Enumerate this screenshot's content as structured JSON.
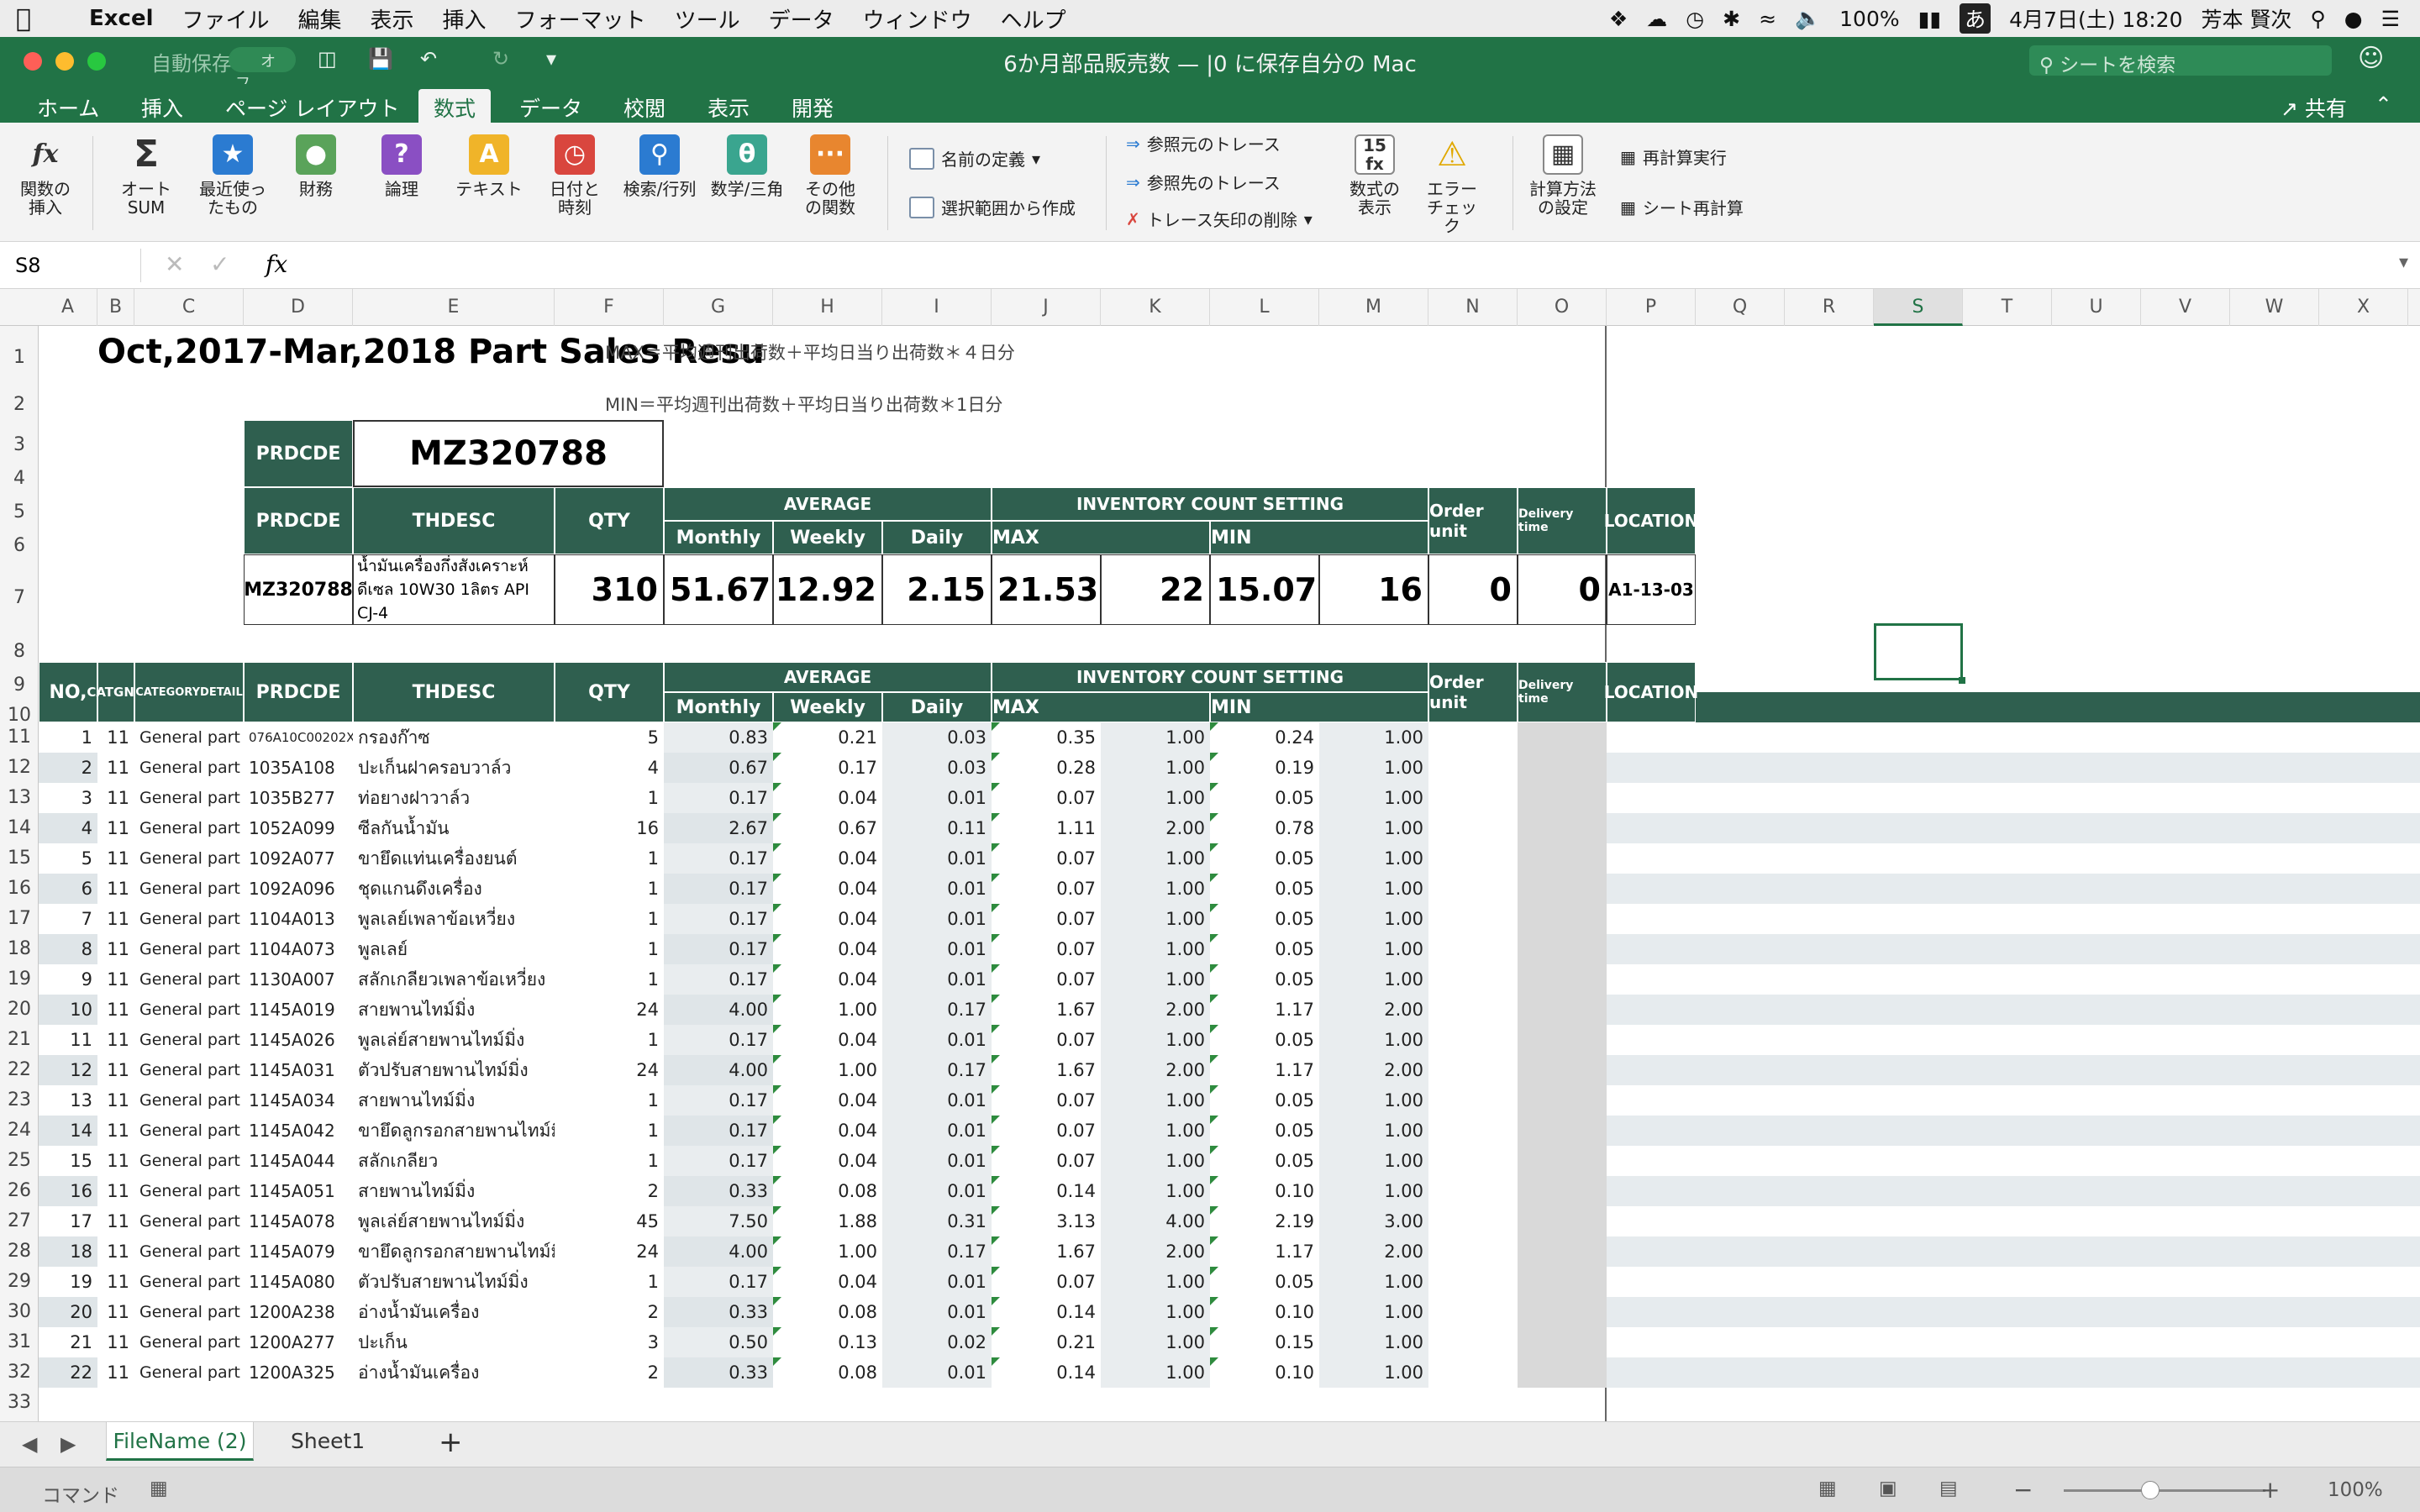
{
  "menubar": {
    "app": "Excel",
    "items": [
      "ファイル",
      "編集",
      "表示",
      "挿入",
      "フォーマット",
      "ツール",
      "データ",
      "ウィンドウ",
      "ヘルプ"
    ],
    "battery": "100%",
    "input": "あ",
    "datetime": "4月7日(土)  18:20",
    "user": "芳本 賢次"
  },
  "titlebar": {
    "autosave": "自動保存",
    "autosave_state": "オフ",
    "title": "6か月部品販売数 — |0 に保存自分の Mac",
    "search_placeholder": "シートを検索"
  },
  "tabs": [
    "ホーム",
    "挿入",
    "ページ レイアウト",
    "数式",
    "データ",
    "校閲",
    "表示",
    "開発"
  ],
  "share": "共有",
  "ribbon": {
    "large": [
      {
        "l1": "関数の",
        "l2": "挿入"
      },
      {
        "l1": "オート",
        "l2": "SUM"
      },
      {
        "l1": "最近使っ",
        "l2": "たもの"
      },
      {
        "l1": "財務",
        "l2": ""
      },
      {
        "l1": "論理",
        "l2": ""
      },
      {
        "l1": "テキスト",
        "l2": ""
      },
      {
        "l1": "日付と",
        "l2": "時刻"
      },
      {
        "l1": "検索/行列",
        "l2": ""
      },
      {
        "l1": "数学/三角",
        "l2": ""
      },
      {
        "l1": "その他",
        "l2": "の関数"
      }
    ],
    "define_name": "名前の定義",
    "create_from_selection": "選択範囲から作成",
    "trace_precedents": "参照元のトレース",
    "trace_dependents": "参照先のトレース",
    "remove_arrows": "トレース矢印の削除",
    "show_formulas_1": "数式の",
    "show_formulas_2": "表示",
    "error_check_1": "エラー",
    "error_check_2": "チェック",
    "calc_options_1": "計算方法",
    "calc_options_2": "の設定",
    "calc_now": "再計算実行",
    "calc_sheet": "シート再計算"
  },
  "formula": {
    "namebox": "S8",
    "fx": "fx",
    "content": ""
  },
  "columns": [
    "A",
    "B",
    "C",
    "D",
    "E",
    "F",
    "G",
    "H",
    "I",
    "J",
    "K",
    "L",
    "M",
    "N",
    "O",
    "P",
    "Q",
    "R",
    "S",
    "T",
    "U",
    "V",
    "W",
    "X"
  ],
  "sheet": {
    "title": "Oct,2017-Mar,2018 Part Sales Resu",
    "max_note": "MAX＝平均週刊出荷数＋平均日当り出荷数＊４日分",
    "min_note": "MIN＝平均週刊出荷数＋平均日当り出荷数＊1日分",
    "prdcde_label": "PRDCDE",
    "prdcde_value": "MZ320788",
    "hdr": {
      "prdcde": "PRDCDE",
      "thdesc": "THDESC",
      "qty": "QTY",
      "average": "AVERAGE",
      "inventory": "INVENTORY COUNT SETTING",
      "monthly": "Monthly",
      "weekly": "Weekly",
      "daily": "Daily",
      "max": "MAX",
      "min": "MIN",
      "order_unit": "Order unit",
      "delivery": "Delivery time",
      "location": "LOCATION",
      "no": "NO,",
      "catgno": "CATGNO",
      "catdetail": "CATEGORYDETAIL"
    },
    "summary": {
      "prdcde": "MZ320788",
      "thdesc": "น้ำมันเครื่องกึ่งสังเคราะห์ ดีเซล 10W30 1ลิตร API CJ-4",
      "qty": "310",
      "monthly": "51.67",
      "weekly": "12.92",
      "daily": "2.15",
      "max": "21.53",
      "max_r": "22",
      "min": "15.07",
      "min_r": "16",
      "order": "0",
      "delivery": "0",
      "location": "A1-13-03"
    },
    "rows": [
      [
        "1",
        "11",
        "General part",
        "076A10C00202X",
        "กรองก๊าซ",
        "5",
        "0.83",
        "0.21",
        "0.03",
        "0.35",
        "1.00",
        "0.24",
        "1.00"
      ],
      [
        "2",
        "11",
        "General part",
        "1035A108",
        "ปะเก็นฝาครอบวาล์ว",
        "4",
        "0.67",
        "0.17",
        "0.03",
        "0.28",
        "1.00",
        "0.19",
        "1.00"
      ],
      [
        "3",
        "11",
        "General part",
        "1035B277",
        "ท่อยางฝาวาล์ว",
        "1",
        "0.17",
        "0.04",
        "0.01",
        "0.07",
        "1.00",
        "0.05",
        "1.00"
      ],
      [
        "4",
        "11",
        "General part",
        "1052A099",
        "ซีลกันน้ำมัน",
        "16",
        "2.67",
        "0.67",
        "0.11",
        "1.11",
        "2.00",
        "0.78",
        "1.00"
      ],
      [
        "5",
        "11",
        "General part",
        "1092A077",
        "ขายึดแท่นเครื่องยนต์",
        "1",
        "0.17",
        "0.04",
        "0.01",
        "0.07",
        "1.00",
        "0.05",
        "1.00"
      ],
      [
        "6",
        "11",
        "General part",
        "1092A096",
        "ชุดแกนดึงเครื่อง",
        "1",
        "0.17",
        "0.04",
        "0.01",
        "0.07",
        "1.00",
        "0.05",
        "1.00"
      ],
      [
        "7",
        "11",
        "General part",
        "1104A013",
        "พูลเลย์เพลาข้อเหวี่ยง",
        "1",
        "0.17",
        "0.04",
        "0.01",
        "0.07",
        "1.00",
        "0.05",
        "1.00"
      ],
      [
        "8",
        "11",
        "General part",
        "1104A073",
        "พูลเลย์",
        "1",
        "0.17",
        "0.04",
        "0.01",
        "0.07",
        "1.00",
        "0.05",
        "1.00"
      ],
      [
        "9",
        "11",
        "General part",
        "1130A007",
        "สลักเกลียวเพลาข้อเหวี่ยง",
        "1",
        "0.17",
        "0.04",
        "0.01",
        "0.07",
        "1.00",
        "0.05",
        "1.00"
      ],
      [
        "10",
        "11",
        "General part",
        "1145A019",
        "สายพานไทม์มิ่ง",
        "24",
        "4.00",
        "1.00",
        "0.17",
        "1.67",
        "2.00",
        "1.17",
        "2.00"
      ],
      [
        "11",
        "11",
        "General part",
        "1145A026",
        "พูลเล่ย์สายพานไทม์มิ่ง",
        "1",
        "0.17",
        "0.04",
        "0.01",
        "0.07",
        "1.00",
        "0.05",
        "1.00"
      ],
      [
        "12",
        "11",
        "General part",
        "1145A031",
        "ตัวปรับสายพานไทม์มิ่ง",
        "24",
        "4.00",
        "1.00",
        "0.17",
        "1.67",
        "2.00",
        "1.17",
        "2.00"
      ],
      [
        "13",
        "11",
        "General part",
        "1145A034",
        "สายพานไทม์มิ่ง",
        "1",
        "0.17",
        "0.04",
        "0.01",
        "0.07",
        "1.00",
        "0.05",
        "1.00"
      ],
      [
        "14",
        "11",
        "General part",
        "1145A042",
        "ขายึดลูกรอกสายพานไทม์มิ่ง",
        "1",
        "0.17",
        "0.04",
        "0.01",
        "0.07",
        "1.00",
        "0.05",
        "1.00"
      ],
      [
        "15",
        "11",
        "General part",
        "1145A044",
        "สลักเกลียว",
        "1",
        "0.17",
        "0.04",
        "0.01",
        "0.07",
        "1.00",
        "0.05",
        "1.00"
      ],
      [
        "16",
        "11",
        "General part",
        "1145A051",
        "สายพานไทม์มิ่ง",
        "2",
        "0.33",
        "0.08",
        "0.01",
        "0.14",
        "1.00",
        "0.10",
        "1.00"
      ],
      [
        "17",
        "11",
        "General part",
        "1145A078",
        "พูลเล่ย์สายพานไทม์มิ่ง",
        "45",
        "7.50",
        "1.88",
        "0.31",
        "3.13",
        "4.00",
        "2.19",
        "3.00"
      ],
      [
        "18",
        "11",
        "General part",
        "1145A079",
        "ขายึดลูกรอกสายพานไทม์มิ่ง",
        "24",
        "4.00",
        "1.00",
        "0.17",
        "1.67",
        "2.00",
        "1.17",
        "2.00"
      ],
      [
        "19",
        "11",
        "General part",
        "1145A080",
        "ตัวปรับสายพานไทม์มิ่ง",
        "1",
        "0.17",
        "0.04",
        "0.01",
        "0.07",
        "1.00",
        "0.05",
        "1.00"
      ],
      [
        "20",
        "11",
        "General part",
        "1200A238",
        "อ่างน้ำมันเครื่อง",
        "2",
        "0.33",
        "0.08",
        "0.01",
        "0.14",
        "1.00",
        "0.10",
        "1.00"
      ],
      [
        "21",
        "11",
        "General part",
        "1200A277",
        "ปะเก็น",
        "3",
        "0.50",
        "0.13",
        "0.02",
        "0.21",
        "1.00",
        "0.15",
        "1.00"
      ],
      [
        "22",
        "11",
        "General part",
        "1200A325",
        "อ่างน้ำมันเครื่อง",
        "2",
        "0.33",
        "0.08",
        "0.01",
        "0.14",
        "1.00",
        "0.10",
        "1.00"
      ]
    ]
  },
  "sheettabs": [
    "FileName (2)",
    "Sheet1"
  ],
  "status": {
    "mode": "コマンド",
    "zoom": "100%"
  }
}
